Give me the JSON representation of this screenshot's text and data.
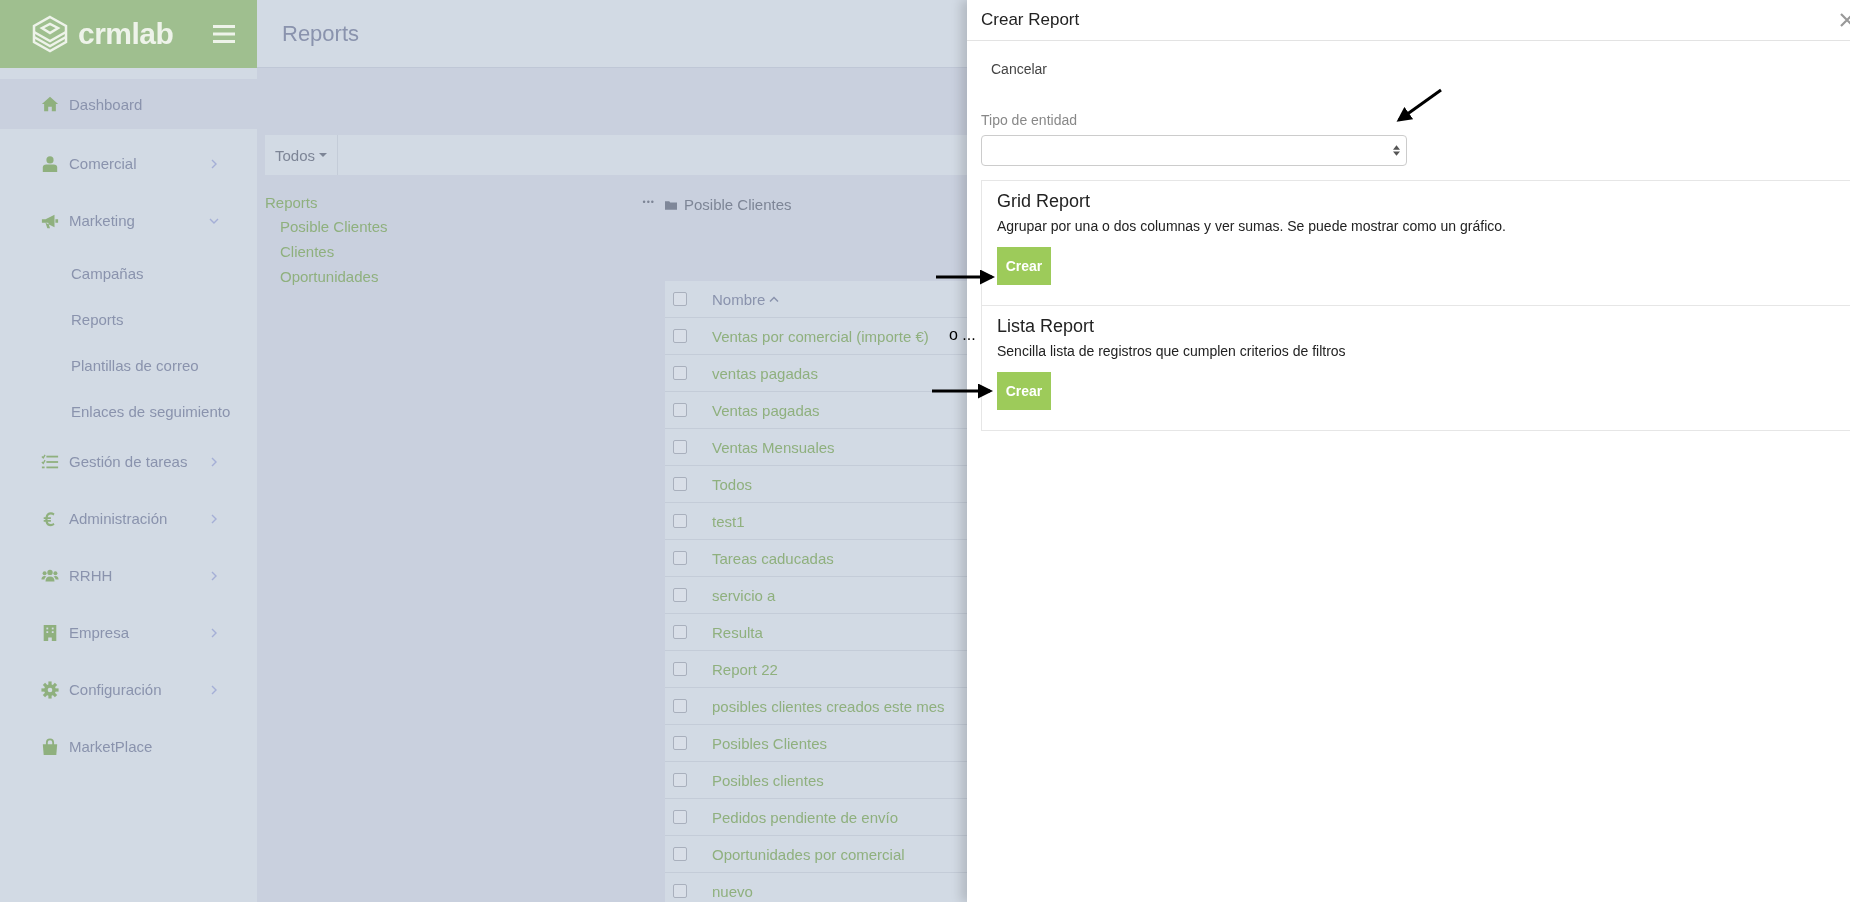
{
  "app": {
    "logo": "crmlab",
    "page_title": "Reports"
  },
  "sidebar": {
    "items": [
      {
        "label": "Dashboard",
        "selected": true
      },
      {
        "label": "Comercial",
        "selected": false,
        "expanded": false
      },
      {
        "label": "Marketing",
        "selected": false,
        "expanded": true,
        "children": [
          {
            "label": "Campañas"
          },
          {
            "label": "Reports"
          },
          {
            "label": "Plantillas de correo"
          },
          {
            "label": "Enlaces de seguimiento"
          }
        ]
      },
      {
        "label": "Gestión de tareas",
        "selected": false,
        "expanded": false
      },
      {
        "label": "Administración",
        "selected": false,
        "expanded": false
      },
      {
        "label": "RRHH",
        "selected": false,
        "expanded": false
      },
      {
        "label": "Empresa",
        "selected": false,
        "expanded": false
      },
      {
        "label": "Configuración",
        "selected": false,
        "expanded": false
      },
      {
        "label": "MarketPlace",
        "selected": false
      }
    ]
  },
  "toolbar": {
    "filter": "Todos"
  },
  "folder_tree": {
    "label": "Reports",
    "children": [
      {
        "label": "Posible Clientes"
      },
      {
        "label": "Clientes"
      },
      {
        "label": "Oportunidades"
      }
    ]
  },
  "folder_menu": "•••",
  "current_folder": "Posible Clientes",
  "table": {
    "all_checked": false,
    "columns": [
      {
        "label": "Nombre"
      }
    ],
    "rows": [
      {
        "name": "Ventas por comercial (importe €)",
        "checked": false
      },
      {
        "name": "ventas pagadas",
        "checked": false
      },
      {
        "name": "Ventas pagadas",
        "checked": false
      },
      {
        "name": "Ventas Mensuales",
        "checked": false
      },
      {
        "name": "Todos",
        "checked": false
      },
      {
        "name": "test1",
        "checked": false
      },
      {
        "name": "Tareas caducadas",
        "checked": false
      },
      {
        "name": "servicio a",
        "checked": false
      },
      {
        "name": "Resulta",
        "checked": false
      },
      {
        "name": "Report 22",
        "checked": false
      },
      {
        "name": "posibles clientes creados este mes",
        "checked": false
      },
      {
        "name": "Posibles Clientes",
        "checked": false
      },
      {
        "name": "Posibles clientes",
        "checked": false
      },
      {
        "name": "Pedidos pendiente de envío",
        "checked": false
      },
      {
        "name": "Oportunidades por comercial",
        "checked": false
      },
      {
        "name": "nuevo",
        "checked": false
      }
    ]
  },
  "panel": {
    "title": "Crear Report",
    "cancel": "Cancelar",
    "entity_field": {
      "label": "Tipo de entidad"
    },
    "report_types": [
      {
        "title": "Grid Report",
        "description": "Agrupar por una o dos columnas y ver sumas. Se puede mostrar como un gráfico.",
        "button": "Crear"
      },
      {
        "title": "Lista Report",
        "description": "Sencilla lista de registros que cumplen criterios de filtros",
        "button": "Crear"
      }
    ]
  },
  "annotation": {
    "note": "o ..."
  }
}
